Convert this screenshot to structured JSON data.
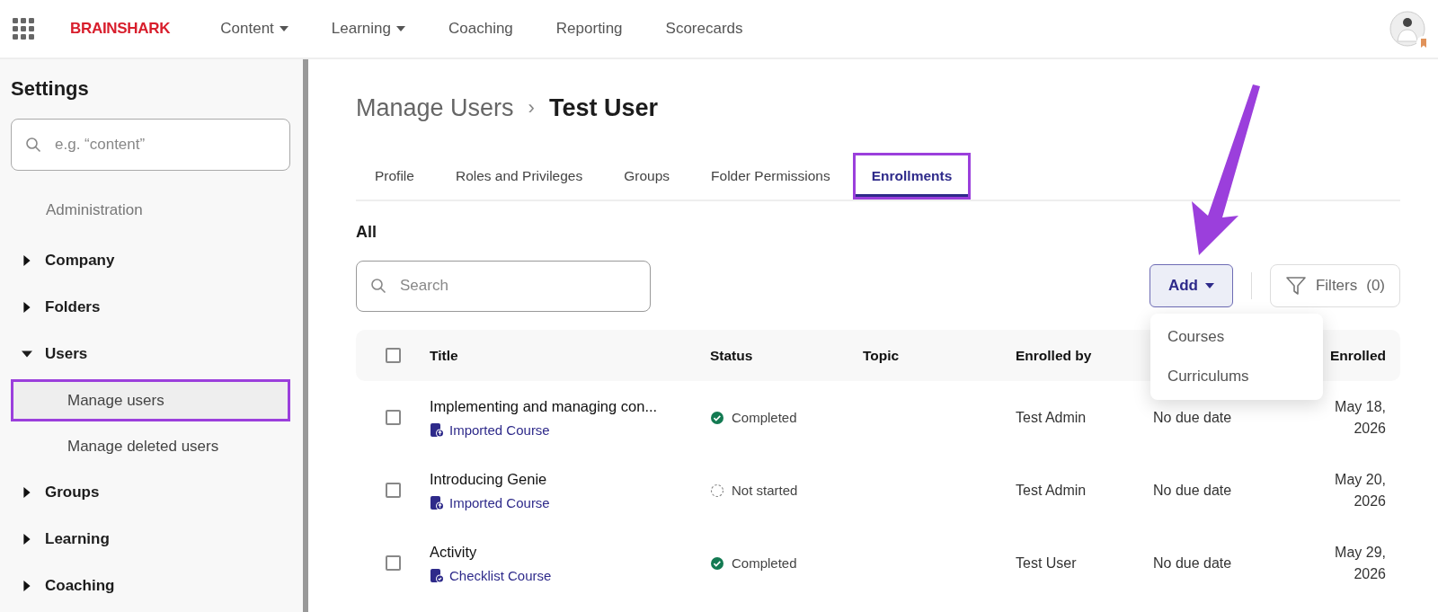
{
  "nav": {
    "brand": "BRAINSHARK",
    "items": [
      {
        "label": "Content",
        "dropdown": true
      },
      {
        "label": "Learning",
        "dropdown": true
      },
      {
        "label": "Coaching",
        "dropdown": false
      },
      {
        "label": "Reporting",
        "dropdown": false
      },
      {
        "label": "Scorecards",
        "dropdown": false
      }
    ]
  },
  "sidebar": {
    "title": "Settings",
    "search": {
      "placeholder": "e.g. “content”"
    },
    "section": "Administration",
    "items": [
      {
        "label": "Company",
        "expanded": false
      },
      {
        "label": "Folders",
        "expanded": false
      },
      {
        "label": "Users",
        "expanded": true,
        "children": [
          {
            "label": "Manage users",
            "selected": true,
            "highlighted": true
          },
          {
            "label": "Manage deleted users",
            "selected": false,
            "highlighted": false
          }
        ]
      },
      {
        "label": "Groups",
        "expanded": false
      },
      {
        "label": "Learning",
        "expanded": false
      },
      {
        "label": "Coaching",
        "expanded": false
      }
    ]
  },
  "breadcrumb": {
    "parent": "Manage Users",
    "separator": "›",
    "current": "Test User"
  },
  "tabs": [
    {
      "label": "Profile",
      "selected": false,
      "highlighted": false
    },
    {
      "label": "Roles and Privileges",
      "selected": false,
      "highlighted": false
    },
    {
      "label": "Groups",
      "selected": false,
      "highlighted": false
    },
    {
      "label": "Folder Permissions",
      "selected": false,
      "highlighted": false
    },
    {
      "label": "Enrollments",
      "selected": true,
      "highlighted": true
    }
  ],
  "filter_label": "All",
  "search": {
    "placeholder": "Search"
  },
  "add_button": {
    "label": "Add",
    "open": true
  },
  "filters_button": {
    "label": "Filters",
    "count": "(0)"
  },
  "add_menu": [
    "Courses",
    "Curriculums"
  ],
  "table": {
    "all_checked": false,
    "columns": [
      "Title",
      "Status",
      "Topic",
      "Enrolled by",
      "Enrolled"
    ],
    "rows": [
      {
        "checked": false,
        "title": "Implementing and managing con...",
        "type": {
          "label": "Imported Course",
          "kind": "imported"
        },
        "status": {
          "label": "Completed",
          "kind": "completed"
        },
        "enrolled_by": "Test Admin",
        "due": "No due date",
        "enrolled": "May 18, 2026"
      },
      {
        "checked": false,
        "title": "Introducing Genie",
        "type": {
          "label": "Imported Course",
          "kind": "imported"
        },
        "status": {
          "label": "Not started",
          "kind": "not_started"
        },
        "enrolled_by": "Test Admin",
        "due": "No due date",
        "enrolled": "May 20, 2026"
      },
      {
        "checked": false,
        "title": "Activity",
        "type": {
          "label": "Checklist Course",
          "kind": "checklist"
        },
        "status": {
          "label": "Completed",
          "kind": "completed"
        },
        "enrolled_by": "Test User",
        "due": "No due date",
        "enrolled": "May 29, 2026"
      }
    ]
  }
}
